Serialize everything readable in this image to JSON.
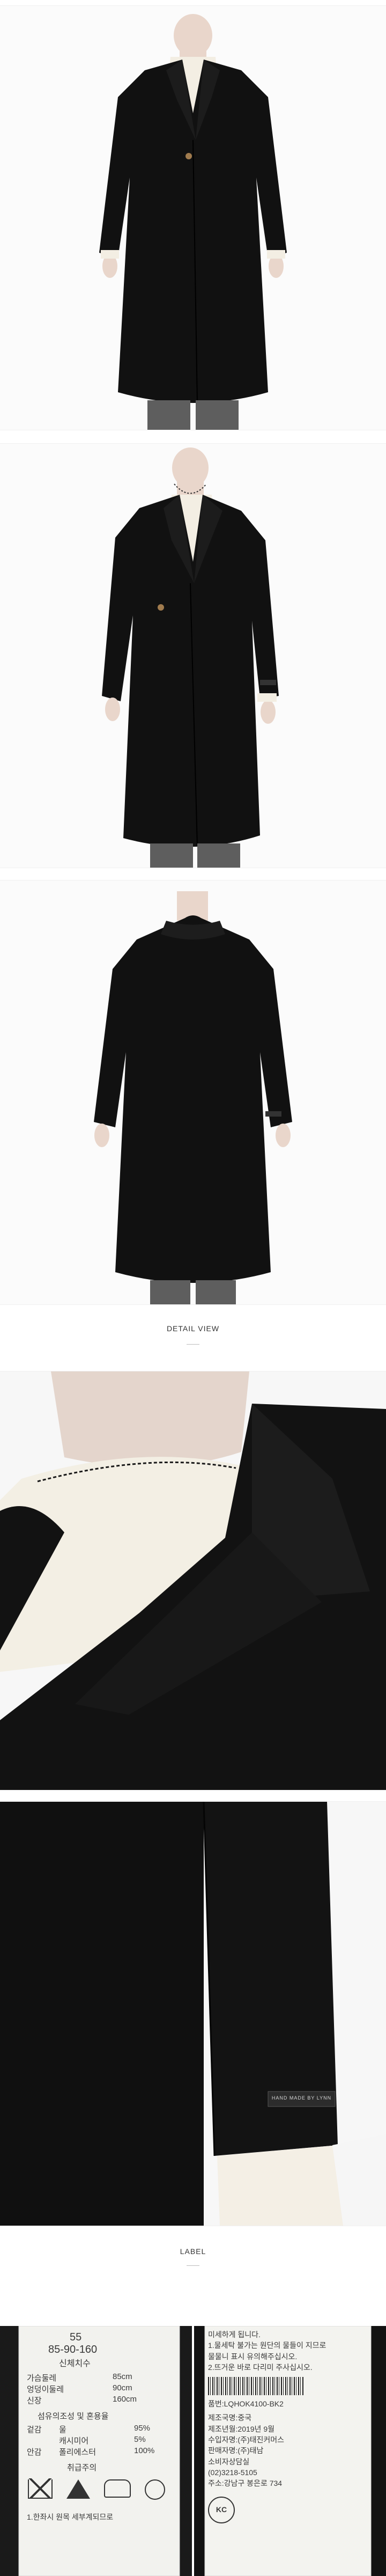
{
  "sections": {
    "detail_view": "DETAIL VIEW",
    "label": "LABEL"
  },
  "sleeve_tag": "HAND MADE BY LYNN",
  "care_label": {
    "size": "55",
    "measurements": "85-90-160",
    "measurements_caption": "신체치수",
    "rows": [
      [
        "가슴둘레",
        "85cm"
      ],
      [
        "엉덩이둘레",
        "90cm"
      ],
      [
        "신장",
        "160cm"
      ]
    ],
    "fiber_heading": "섬유의조성 및 혼용율",
    "fibers": [
      [
        "겉감",
        "울",
        "95%"
      ],
      [
        "",
        "캐시미어",
        "5%"
      ],
      [
        "안감",
        "폴리에스터",
        "100%"
      ]
    ],
    "care_heading": "취급주의",
    "footer": "1.한좌시 원목 세부계되므로"
  },
  "info_label": {
    "notice_lines": [
      "미세하게 됩니다.",
      "1.물세탁 불가는 원단의 물들이 지므로",
      "물물니 표시 유의해주십시오.",
      "2.뜨거운 바로 다리미 주사십시오."
    ],
    "product_code": "품번:LQHOK4100-BK2",
    "details": [
      "제조국명:중국",
      "제조년월:2019년 9월",
      "수입자명:(주)태진커머스",
      "판매자명:(주)태남",
      "소비자상담실",
      "(02)3218-5105",
      "주소:강남구 봉은로 734"
    ],
    "cert": "KC"
  }
}
